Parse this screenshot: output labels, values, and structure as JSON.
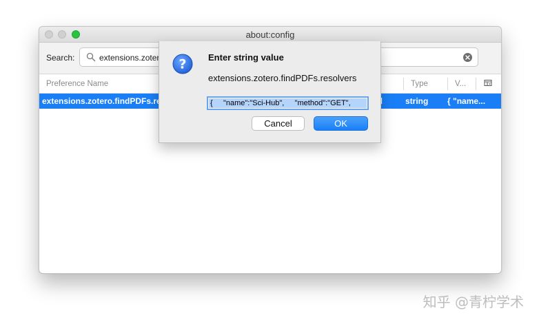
{
  "window": {
    "title": "about:config"
  },
  "search": {
    "label": "Search:",
    "value": "extensions.zotero"
  },
  "table": {
    "columns": [
      "Preference Name",
      "Type",
      "V..."
    ],
    "row": {
      "name": "extensions.zotero.findPDFs.resolvers",
      "status_partial": "ed",
      "type": "string",
      "value": "{     \"name..."
    }
  },
  "dialog": {
    "title": "Enter string value",
    "preference": "extensions.zotero.findPDFs.resolvers",
    "input_value": "{     \"name\":\"Sci-Hub\",     \"method\":\"GET\",",
    "cancel_label": "Cancel",
    "ok_label": "OK"
  },
  "watermark": "知乎 @青柠学术",
  "colors": {
    "accent": "#1a7ff7",
    "zoom_button": "#2bc23f",
    "help_icon": "#2d6fe0"
  }
}
